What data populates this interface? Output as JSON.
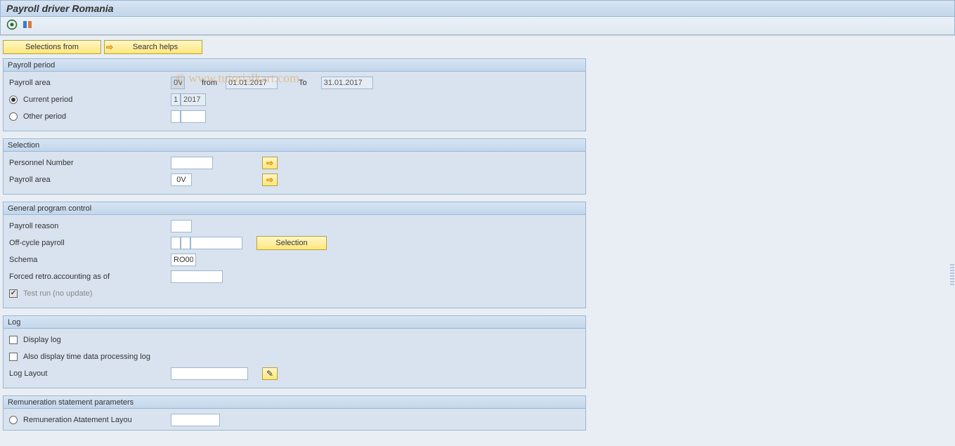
{
  "title": "Payroll driver Romania",
  "watermark": "© www.tutorialkart.com",
  "toolbar": {
    "execute_icon": "execute-icon",
    "variant_icon": "variant-icon"
  },
  "actions": {
    "selections_from": "Selections from",
    "search_helps": "Search helps"
  },
  "payroll_period": {
    "header": "Payroll period",
    "payroll_area_label": "Payroll area",
    "payroll_area_value": "0V",
    "from_label": "from",
    "from_value": "01.01.2017",
    "to_label": "To",
    "to_value": "31.01.2017",
    "current_period_label": "Current period",
    "current_period_num": "1",
    "current_period_year": "2017",
    "other_period_label": "Other period",
    "other_period_num": "",
    "other_period_year": ""
  },
  "selection": {
    "header": "Selection",
    "personnel_number_label": "Personnel Number",
    "personnel_number_value": "",
    "payroll_area_label": "Payroll area",
    "payroll_area_value": "0V"
  },
  "general": {
    "header": "General program control",
    "payroll_reason_label": "Payroll reason",
    "payroll_reason_value": "",
    "offcycle_label": "Off-cycle payroll",
    "offcycle_v1": "",
    "offcycle_v2": "",
    "offcycle_v3": "",
    "selection_btn": "Selection",
    "schema_label": "Schema",
    "schema_value": "RO00",
    "forced_retro_label": "Forced retro.accounting as of",
    "forced_retro_value": "",
    "test_run_label": "Test run (no update)"
  },
  "log": {
    "header": "Log",
    "display_log_label": "Display log",
    "also_display_label": "Also display time data processing log",
    "log_layout_label": "Log Layout",
    "log_layout_value": ""
  },
  "remun": {
    "header": "Remuneration statement parameters",
    "layout_label": "Remuneration Atatement Layou",
    "layout_value": ""
  }
}
